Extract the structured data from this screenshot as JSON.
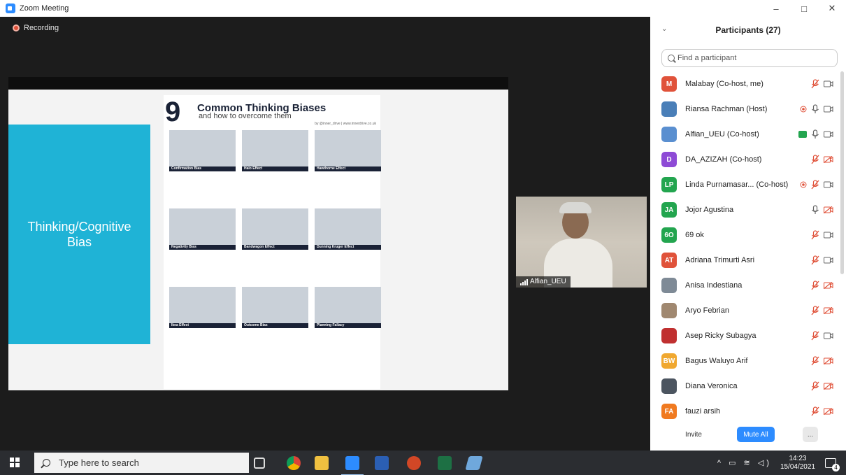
{
  "window": {
    "title": "Zoom Meeting",
    "controls": {
      "minimize": "–",
      "maximize": "□",
      "close": "✕"
    }
  },
  "meeting": {
    "recording_label": "Recording"
  },
  "slide": {
    "left_title": "Thinking/Cognitive Bias",
    "infographic": {
      "number": "9",
      "title": "Common Thinking Biases",
      "subtitle": "and how to overcome them",
      "credit": "by @inner_drive | www.innerdrive.co.uk",
      "cells": [
        {
          "label": "Confirmation Bias"
        },
        {
          "label": "Halo Effect"
        },
        {
          "label": "Hawthorne Effect"
        },
        {
          "label": "Negativity Bias"
        },
        {
          "label": "Bandwagon Effect"
        },
        {
          "label": "Dunning Kruger Effect"
        },
        {
          "label": "Ikea Effect"
        },
        {
          "label": "Outcome Bias"
        },
        {
          "label": "Planning Fallacy"
        }
      ]
    }
  },
  "video": {
    "name": "Alfian_UEU"
  },
  "participants": {
    "title": "Participants (27)",
    "search_placeholder": "Find a participant",
    "list": [
      {
        "initials": "M",
        "name": "Malabay (Co-host, me)",
        "color": "#e0523a",
        "photo": false,
        "mic": "muted",
        "cam": "on",
        "rec": false,
        "share": false
      },
      {
        "initials": "",
        "name": "Riansa Rachman (Host)",
        "color": "#4a7fb8",
        "photo": true,
        "mic": "on",
        "cam": "on",
        "rec": true,
        "share": false
      },
      {
        "initials": "",
        "name": "Alfian_UEU (Co-host)",
        "color": "#5a8fd0",
        "photo": true,
        "mic": "on",
        "cam": "on",
        "rec": false,
        "share": true
      },
      {
        "initials": "D",
        "name": "DA_AZIZAH (Co-host)",
        "color": "#8e4bd6",
        "photo": false,
        "mic": "muted",
        "cam": "off",
        "rec": false,
        "share": false
      },
      {
        "initials": "LP",
        "name": "Linda Purnamasar... (Co-host)",
        "color": "#23a54f",
        "photo": false,
        "mic": "muted",
        "cam": "on",
        "rec": true,
        "share": false
      },
      {
        "initials": "JA",
        "name": "Jojor Agustina",
        "color": "#23a54f",
        "photo": false,
        "mic": "on",
        "cam": "off",
        "rec": false,
        "share": false
      },
      {
        "initials": "6O",
        "name": "69 ok",
        "color": "#23a54f",
        "photo": false,
        "mic": "muted",
        "cam": "on",
        "rec": false,
        "share": false
      },
      {
        "initials": "AT",
        "name": "Adriana Trimurti Asri",
        "color": "#e0523a",
        "photo": false,
        "mic": "muted",
        "cam": "on",
        "rec": false,
        "share": false
      },
      {
        "initials": "",
        "name": "Anisa Indestiana",
        "color": "#7e8a96",
        "photo": true,
        "mic": "muted",
        "cam": "off",
        "rec": false,
        "share": false
      },
      {
        "initials": "",
        "name": "Aryo Febrian",
        "color": "#a08870",
        "photo": true,
        "mic": "muted",
        "cam": "off",
        "rec": false,
        "share": false
      },
      {
        "initials": "",
        "name": "Asep Ricky Subagya",
        "color": "#c03030",
        "photo": true,
        "mic": "muted",
        "cam": "on",
        "rec": false,
        "share": false
      },
      {
        "initials": "BW",
        "name": "Bagus Waluyo Arif",
        "color": "#f0a830",
        "photo": false,
        "mic": "muted",
        "cam": "off",
        "rec": false,
        "share": false
      },
      {
        "initials": "",
        "name": "Diana Veronica",
        "color": "#4c5560",
        "photo": true,
        "mic": "muted",
        "cam": "off",
        "rec": false,
        "share": false
      },
      {
        "initials": "FA",
        "name": "fauzi arsih",
        "color": "#f07a20",
        "photo": false,
        "mic": "muted",
        "cam": "off",
        "rec": false,
        "share": false
      }
    ],
    "footer": {
      "invite": "Invite",
      "mute_all": "Mute All",
      "more": "..."
    }
  },
  "taskbar": {
    "search_placeholder": "Type here to search",
    "time": "14:23",
    "date": "15/04/2021",
    "notification_count": "4"
  }
}
